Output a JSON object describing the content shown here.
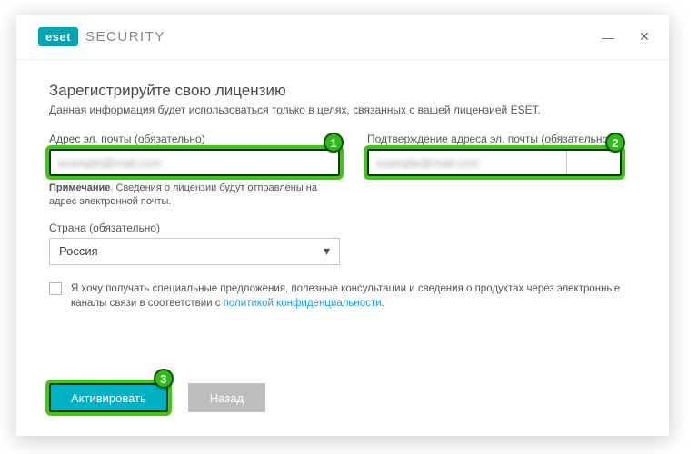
{
  "brand": {
    "logo": "eset",
    "name": "SECURITY"
  },
  "window_controls": {
    "minimize": "—",
    "close": "✕"
  },
  "page": {
    "title": "Зарегистрируйте свою лицензию",
    "subtitle": "Данная информация будет использоваться только в целях, связанных с вашей лицензией ESET."
  },
  "fields": {
    "email": {
      "label": "Адрес эл. почты (обязательно)",
      "value": "example@mail.com"
    },
    "email_confirm": {
      "label": "Подтверждение адреса эл. почты (обязательно)",
      "value": "example@mail.com"
    },
    "note_label": "Примечание",
    "note_text": ". Сведения о лицензии будут отправлены на адрес электронной почты.",
    "country": {
      "label": "Страна (обязательно)",
      "value": "Россия"
    }
  },
  "consent": {
    "text_a": "Я хочу получать специальные предложения, полезные консультации и сведения о продуктах через электронные каналы связи в соответствии с ",
    "link": "политикой конфиденциальности",
    "text_b": "."
  },
  "buttons": {
    "activate": "Активировать",
    "back": "Назад"
  },
  "markers": {
    "m1": "1",
    "m2": "2",
    "m3": "3"
  }
}
